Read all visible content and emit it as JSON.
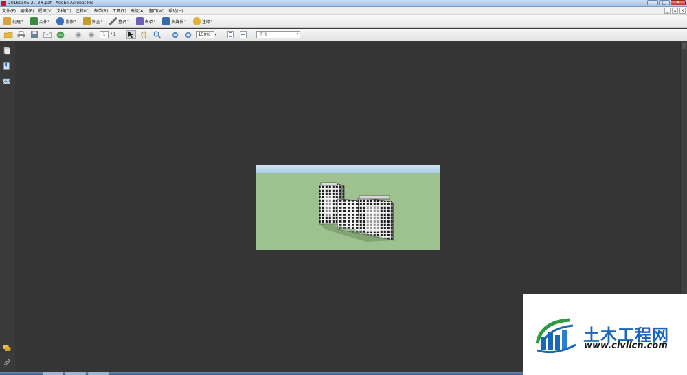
{
  "window": {
    "title": "20160505-2，3#.pdf - Adobe Acrobat Pro",
    "minimize_glyph": "‒",
    "maximize_glyph": "□",
    "close_glyph": "✕"
  },
  "menubar": {
    "items": [
      {
        "label": "文件(F)"
      },
      {
        "label": "编辑(E)"
      },
      {
        "label": "视图(V)"
      },
      {
        "label": "文档(D)"
      },
      {
        "label": "注释(C)"
      },
      {
        "label": "表单(R)"
      },
      {
        "label": "工具(T)"
      },
      {
        "label": "高级(A)"
      },
      {
        "label": "窗口(W)"
      },
      {
        "label": "帮助(H)"
      }
    ],
    "mdi": {
      "min": "_",
      "restore": "▫",
      "close": "x"
    }
  },
  "task_toolbar": {
    "buttons": [
      {
        "label": "创建",
        "icon": "create-pdf-icon",
        "color": "#d9a23a"
      },
      {
        "label": "合并",
        "icon": "combine-icon",
        "color": "#3b8a3e"
      },
      {
        "label": "协作",
        "icon": "collaborate-icon",
        "color": "#3d6fb6"
      },
      {
        "label": "安全",
        "icon": "lock-icon",
        "color": "#c79a2b"
      },
      {
        "label": "签名",
        "icon": "pen-sign-icon",
        "color": "#6a6a6a"
      },
      {
        "label": "表单",
        "icon": "form-icon",
        "color": "#6d5fb8"
      },
      {
        "label": "多媒体",
        "icon": "multimedia-icon",
        "color": "#3a6aa8"
      },
      {
        "label": "注释",
        "icon": "comment-icon",
        "color": "#e0b23c"
      }
    ],
    "caret": "▾"
  },
  "nav_toolbar": {
    "page_current": "1",
    "page_total": "/ 1",
    "zoom": "150%",
    "find_placeholder": "查找",
    "caret": "▾"
  },
  "left_panel": {
    "icons": [
      "pages-icon",
      "bookmarks-icon",
      "signatures-icon",
      "comments-icon",
      "attachments-icon"
    ]
  },
  "document": {
    "page_bg": "#9ec28f",
    "sky_color": "#a9cde6"
  },
  "watermark": {
    "brand": "土木工程网",
    "url": "www.civilcn.com",
    "brand_color": "#1a66b8"
  }
}
